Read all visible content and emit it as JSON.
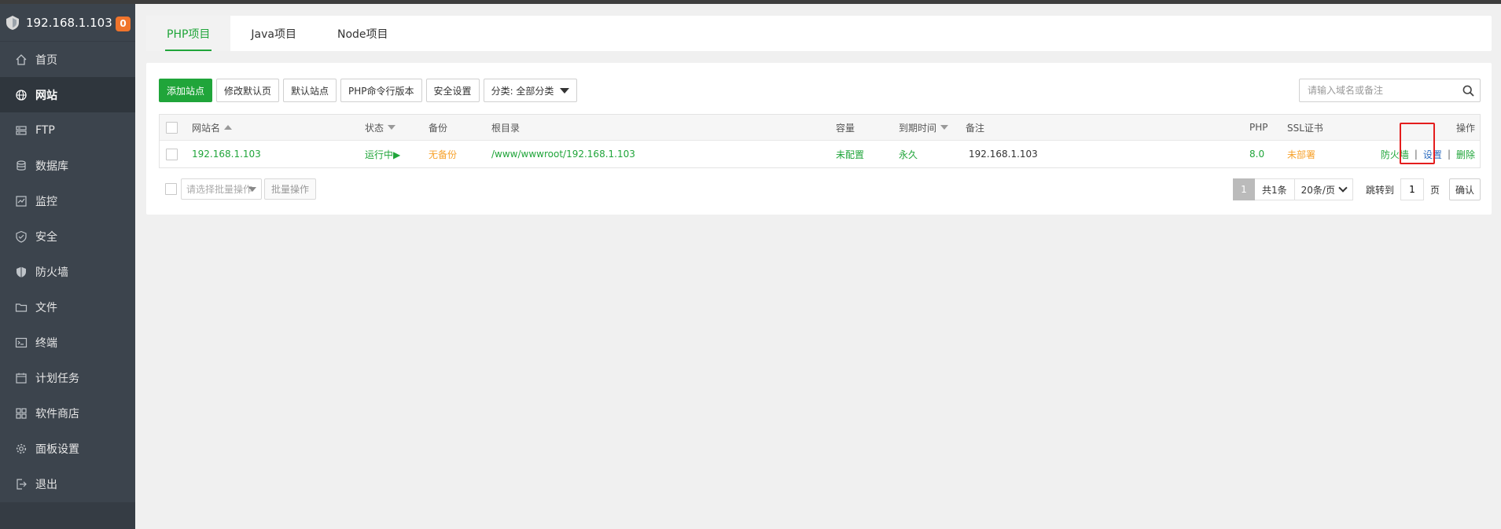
{
  "sidebar": {
    "host": "192.168.1.103",
    "badge": "0",
    "items": [
      {
        "label": "首页",
        "icon": "home-icon"
      },
      {
        "label": "网站",
        "icon": "globe-icon",
        "active": true
      },
      {
        "label": "FTP",
        "icon": "ftp-icon"
      },
      {
        "label": "数据库",
        "icon": "database-icon"
      },
      {
        "label": "监控",
        "icon": "monitor-icon"
      },
      {
        "label": "安全",
        "icon": "shield-icon"
      },
      {
        "label": "防火墙",
        "icon": "firewall-icon"
      },
      {
        "label": "文件",
        "icon": "folder-icon"
      },
      {
        "label": "终端",
        "icon": "terminal-icon"
      },
      {
        "label": "计划任务",
        "icon": "calendar-icon"
      },
      {
        "label": "软件商店",
        "icon": "apps-icon"
      },
      {
        "label": "面板设置",
        "icon": "gear-icon"
      },
      {
        "label": "退出",
        "icon": "logout-icon"
      }
    ]
  },
  "tabs": [
    {
      "label": "PHP项目",
      "active": true
    },
    {
      "label": "Java项目"
    },
    {
      "label": "Node项目"
    }
  ],
  "toolbar": {
    "add_site": "添加站点",
    "edit_default_page": "修改默认页",
    "default_site": "默认站点",
    "php_cli_version": "PHP命令行版本",
    "security_settings": "安全设置",
    "category": "分类: 全部分类"
  },
  "search": {
    "placeholder": "请输入域名或备注"
  },
  "table": {
    "headers": {
      "site_name": "网站名",
      "status": "状态",
      "backup": "备份",
      "root_dir": "根目录",
      "capacity": "容量",
      "expire": "到期时间",
      "remark": "备注",
      "php": "PHP",
      "ssl": "SSL证书",
      "ops": "操作"
    },
    "rows": [
      {
        "site_name": "192.168.1.103",
        "status": "运行中▶",
        "backup": "无备份",
        "root_dir": "/www/wwwroot/192.168.1.103",
        "capacity": "未配置",
        "expire": "永久",
        "remark": "192.168.1.103",
        "php": "8.0",
        "ssl": "未部署",
        "op_firewall": "防火墙",
        "op_settings": "设置",
        "op_delete": "删除"
      }
    ]
  },
  "footer": {
    "batch_placeholder": "请选择批量操作",
    "batch_button": "批量操作",
    "current_page": "1",
    "total": "共1条",
    "per_page": "20条/页",
    "jump_label": "跳转到",
    "jump_value": "1",
    "page_unit": "页",
    "confirm": "确认"
  },
  "colors": {
    "sidebar_bg": "#3c444d",
    "accent_green": "#20a53a",
    "warning_orange": "#f7a22c",
    "badge_orange": "#f0742c",
    "highlight_red": "#e41d1d"
  }
}
